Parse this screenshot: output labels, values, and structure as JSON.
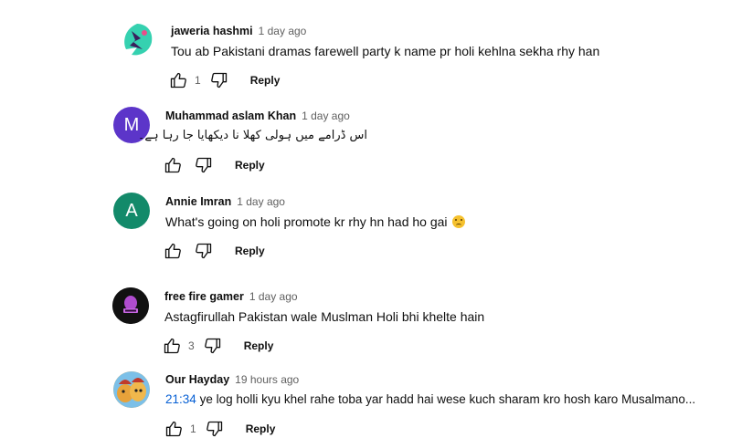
{
  "comments": [
    {
      "author": "jaweria hashmi",
      "time": "1 day ago",
      "text": "Tou ab Pakistani dramas farewell party k name pr holi kehlna sekha rhy han",
      "likes": "1",
      "reply_label": "Reply",
      "avatar": {
        "type": "image",
        "bg": "#ffffff",
        "accent": "#2ec4a6"
      }
    },
    {
      "author": "Muhammad aslam Khan",
      "time": "1 day ago",
      "text": "اس ڈرامے میں ہولی کھلا نا دیکھایا جا رہا ہے۔",
      "likes": "",
      "reply_label": "Reply",
      "avatar": {
        "type": "letter",
        "letter": "M",
        "bg": "#5c35c9"
      }
    },
    {
      "author": "Annie Imran",
      "time": "1 day ago",
      "text": "What's going on holi promote kr rhy hn had ho gai",
      "likes": "",
      "reply_label": "Reply",
      "avatar": {
        "type": "letter",
        "letter": "A",
        "bg": "#138a6a"
      }
    },
    {
      "author": "free fire gamer",
      "time": "1 day ago",
      "text": "Astagfirullah Pakistan wale Muslman Holi bhi khelte hain",
      "likes": "3",
      "reply_label": "Reply",
      "avatar": {
        "type": "image",
        "bg": "#111111",
        "accent": "#b04ccf"
      }
    },
    {
      "author": "Our Hayday",
      "time": "19 hours ago",
      "timestamp_link": "21:34",
      "text": "ye log holli kyu khel rahe toba yar hadd hai wese kuch sharam kro hosh karo Musalmano...",
      "likes": "1",
      "reply_label": "Reply",
      "avatar": {
        "type": "image",
        "bg": "#e8a23a",
        "accent": "#c0392b"
      }
    }
  ],
  "colors": {
    "link": "#065fd4",
    "secondary_text": "#606060",
    "primary_text": "#0f0f0f"
  },
  "icons": [
    "thumb-up-icon",
    "thumb-down-icon",
    "sad-face-emoji"
  ]
}
